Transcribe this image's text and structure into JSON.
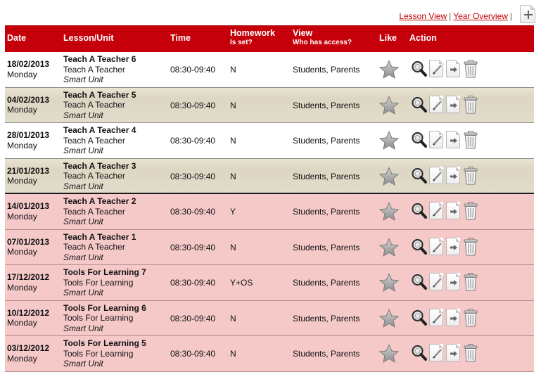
{
  "top_links": {
    "lesson_view": "Lesson View",
    "separator": "|",
    "year_overview": "Year Overview",
    "trailing_separator": "|"
  },
  "colors": {
    "header_red": "#c6000a",
    "link_red": "#c00000",
    "past_row_pink": "#f6c9c9",
    "upcoming_row_beige": "#e2dccb",
    "upcoming_row_white": "#ffffff"
  },
  "header": {
    "date": "Date",
    "lesson": "Lesson/Unit",
    "time": "Time",
    "homework": "Homework",
    "homework_sub": "Is set?",
    "view": "View",
    "view_sub": "Who has access?",
    "like": "Like",
    "action": "Action"
  },
  "rows": [
    {
      "date": "18/02/2013",
      "day": "Monday",
      "title": "Teach A Teacher 6",
      "unit": "Teach A Teacher",
      "unit_type": "Smart Unit",
      "time": "08:30-09:40",
      "homework": "N",
      "view": "Students, Parents",
      "style": "white"
    },
    {
      "date": "04/02/2013",
      "day": "Monday",
      "title": "Teach A Teacher 5",
      "unit": "Teach A Teacher",
      "unit_type": "Smart Unit",
      "time": "08:30-09:40",
      "homework": "N",
      "view": "Students, Parents",
      "style": "beige"
    },
    {
      "date": "28/01/2013",
      "day": "Monday",
      "title": "Teach A Teacher 4",
      "unit": "Teach A Teacher",
      "unit_type": "Smart Unit",
      "time": "08:30-09:40",
      "homework": "N",
      "view": "Students, Parents",
      "style": "white"
    },
    {
      "date": "21/01/2013",
      "day": "Monday",
      "title": "Teach A Teacher 3",
      "unit": "Teach A Teacher",
      "unit_type": "Smart Unit",
      "time": "08:30-09:40",
      "homework": "N",
      "view": "Students, Parents",
      "style": "beige"
    },
    {
      "date": "14/01/2013",
      "day": "Monday",
      "title": "Teach A Teacher 2",
      "unit": "Teach A Teacher",
      "unit_type": "Smart Unit",
      "time": "08:30-09:40",
      "homework": "Y",
      "view": "Students, Parents",
      "style": "past"
    },
    {
      "date": "07/01/2013",
      "day": "Monday",
      "title": "Teach A Teacher 1",
      "unit": "Teach A Teacher",
      "unit_type": "Smart Unit",
      "time": "08:30-09:40",
      "homework": "N",
      "view": "Students, Parents",
      "style": "past"
    },
    {
      "date": "17/12/2012",
      "day": "Monday",
      "title": "Tools For Learning 7",
      "unit": "Tools For Learning",
      "unit_type": "Smart Unit",
      "time": "08:30-09:40",
      "homework": "Y+OS",
      "view": "Students, Parents",
      "style": "past"
    },
    {
      "date": "10/12/2012",
      "day": "Monday",
      "title": "Tools For Learning 6",
      "unit": "Tools For Learning",
      "unit_type": "Smart Unit",
      "time": "08:30-09:40",
      "homework": "N",
      "view": "Students, Parents",
      "style": "past"
    },
    {
      "date": "03/12/2012",
      "day": "Monday",
      "title": "Tools For Learning 5",
      "unit": "Tools For Learning",
      "unit_type": "Smart Unit",
      "time": "08:30-09:40",
      "homework": "N",
      "view": "Students, Parents",
      "style": "past"
    }
  ],
  "icons": {
    "add": "plus-icon",
    "like": "star-icon",
    "view": "magnifier-icon",
    "edit": "pencil-icon",
    "move": "arrow-right-icon",
    "delete": "trash-icon"
  }
}
